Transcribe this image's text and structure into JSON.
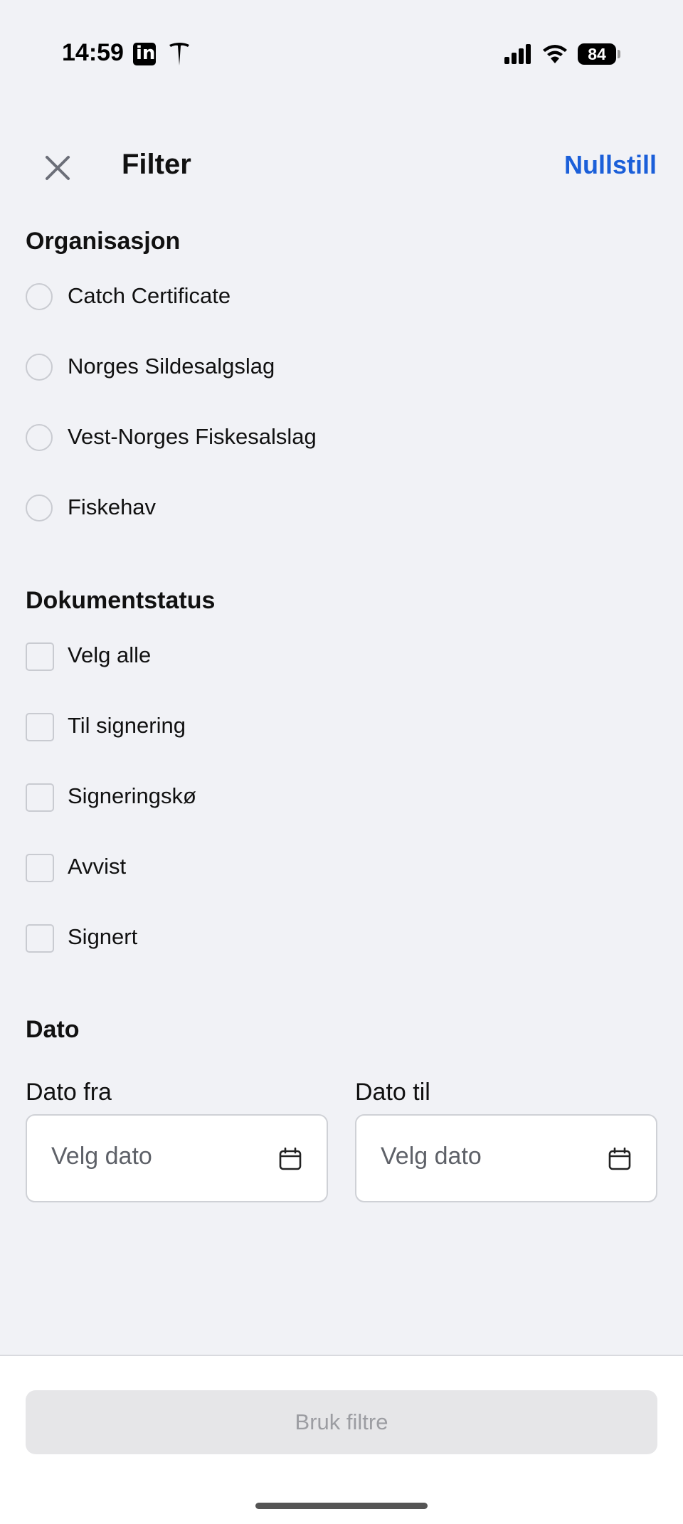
{
  "status_bar": {
    "time": "14:59",
    "battery": "84",
    "icons": [
      "linkedin-icon",
      "tesla-icon",
      "cellular-signal-icon",
      "wifi-icon",
      "battery-icon"
    ]
  },
  "header": {
    "close_icon": "close-icon",
    "title": "Filter",
    "reset_label": "Nullstill"
  },
  "organisation": {
    "title": "Organisasjon",
    "options": [
      {
        "label": "Catch Certificate",
        "selected": false
      },
      {
        "label": "Norges Sildesalgslag",
        "selected": false
      },
      {
        "label": "Vest-Norges Fiskesalslag",
        "selected": false
      },
      {
        "label": "Fiskehav",
        "selected": false
      }
    ]
  },
  "document_status": {
    "title": "Dokumentstatus",
    "options": [
      {
        "label": "Velg alle",
        "checked": false
      },
      {
        "label": "Til signering",
        "checked": false
      },
      {
        "label": "Signeringskø",
        "checked": false
      },
      {
        "label": "Avvist",
        "checked": false
      },
      {
        "label": "Signert",
        "checked": false
      }
    ]
  },
  "date": {
    "title": "Dato",
    "from_label": "Dato fra",
    "from_placeholder": "Velg dato",
    "to_label": "Dato til",
    "to_placeholder": "Velg dato",
    "icon": "calendar-icon"
  },
  "footer": {
    "apply_label": "Bruk filtre"
  },
  "colors": {
    "accent": "#1b5fd9",
    "background": "#f1f2f6",
    "disabled_button": "#e6e6e8",
    "disabled_text": "#9c9da2"
  }
}
